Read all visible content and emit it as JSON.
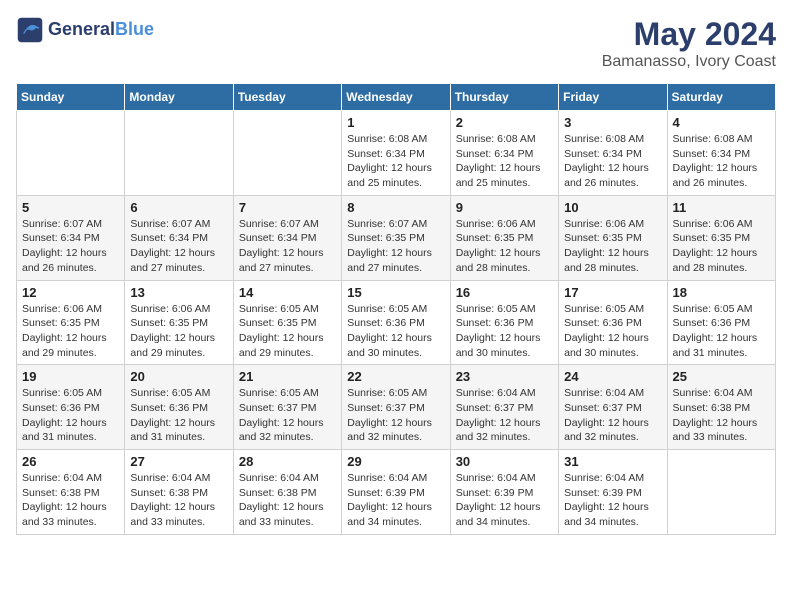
{
  "header": {
    "logo_line1": "General",
    "logo_line2": "Blue",
    "title": "May 2024",
    "subtitle": "Bamanasso, Ivory Coast"
  },
  "weekdays": [
    "Sunday",
    "Monday",
    "Tuesday",
    "Wednesday",
    "Thursday",
    "Friday",
    "Saturday"
  ],
  "weeks": [
    [
      {
        "day": "",
        "info": ""
      },
      {
        "day": "",
        "info": ""
      },
      {
        "day": "",
        "info": ""
      },
      {
        "day": "1",
        "info": "Sunrise: 6:08 AM\nSunset: 6:34 PM\nDaylight: 12 hours\nand 25 minutes."
      },
      {
        "day": "2",
        "info": "Sunrise: 6:08 AM\nSunset: 6:34 PM\nDaylight: 12 hours\nand 25 minutes."
      },
      {
        "day": "3",
        "info": "Sunrise: 6:08 AM\nSunset: 6:34 PM\nDaylight: 12 hours\nand 26 minutes."
      },
      {
        "day": "4",
        "info": "Sunrise: 6:08 AM\nSunset: 6:34 PM\nDaylight: 12 hours\nand 26 minutes."
      }
    ],
    [
      {
        "day": "5",
        "info": "Sunrise: 6:07 AM\nSunset: 6:34 PM\nDaylight: 12 hours\nand 26 minutes."
      },
      {
        "day": "6",
        "info": "Sunrise: 6:07 AM\nSunset: 6:34 PM\nDaylight: 12 hours\nand 27 minutes."
      },
      {
        "day": "7",
        "info": "Sunrise: 6:07 AM\nSunset: 6:34 PM\nDaylight: 12 hours\nand 27 minutes."
      },
      {
        "day": "8",
        "info": "Sunrise: 6:07 AM\nSunset: 6:35 PM\nDaylight: 12 hours\nand 27 minutes."
      },
      {
        "day": "9",
        "info": "Sunrise: 6:06 AM\nSunset: 6:35 PM\nDaylight: 12 hours\nand 28 minutes."
      },
      {
        "day": "10",
        "info": "Sunrise: 6:06 AM\nSunset: 6:35 PM\nDaylight: 12 hours\nand 28 minutes."
      },
      {
        "day": "11",
        "info": "Sunrise: 6:06 AM\nSunset: 6:35 PM\nDaylight: 12 hours\nand 28 minutes."
      }
    ],
    [
      {
        "day": "12",
        "info": "Sunrise: 6:06 AM\nSunset: 6:35 PM\nDaylight: 12 hours\nand 29 minutes."
      },
      {
        "day": "13",
        "info": "Sunrise: 6:06 AM\nSunset: 6:35 PM\nDaylight: 12 hours\nand 29 minutes."
      },
      {
        "day": "14",
        "info": "Sunrise: 6:05 AM\nSunset: 6:35 PM\nDaylight: 12 hours\nand 29 minutes."
      },
      {
        "day": "15",
        "info": "Sunrise: 6:05 AM\nSunset: 6:36 PM\nDaylight: 12 hours\nand 30 minutes."
      },
      {
        "day": "16",
        "info": "Sunrise: 6:05 AM\nSunset: 6:36 PM\nDaylight: 12 hours\nand 30 minutes."
      },
      {
        "day": "17",
        "info": "Sunrise: 6:05 AM\nSunset: 6:36 PM\nDaylight: 12 hours\nand 30 minutes."
      },
      {
        "day": "18",
        "info": "Sunrise: 6:05 AM\nSunset: 6:36 PM\nDaylight: 12 hours\nand 31 minutes."
      }
    ],
    [
      {
        "day": "19",
        "info": "Sunrise: 6:05 AM\nSunset: 6:36 PM\nDaylight: 12 hours\nand 31 minutes."
      },
      {
        "day": "20",
        "info": "Sunrise: 6:05 AM\nSunset: 6:36 PM\nDaylight: 12 hours\nand 31 minutes."
      },
      {
        "day": "21",
        "info": "Sunrise: 6:05 AM\nSunset: 6:37 PM\nDaylight: 12 hours\nand 32 minutes."
      },
      {
        "day": "22",
        "info": "Sunrise: 6:05 AM\nSunset: 6:37 PM\nDaylight: 12 hours\nand 32 minutes."
      },
      {
        "day": "23",
        "info": "Sunrise: 6:04 AM\nSunset: 6:37 PM\nDaylight: 12 hours\nand 32 minutes."
      },
      {
        "day": "24",
        "info": "Sunrise: 6:04 AM\nSunset: 6:37 PM\nDaylight: 12 hours\nand 32 minutes."
      },
      {
        "day": "25",
        "info": "Sunrise: 6:04 AM\nSunset: 6:38 PM\nDaylight: 12 hours\nand 33 minutes."
      }
    ],
    [
      {
        "day": "26",
        "info": "Sunrise: 6:04 AM\nSunset: 6:38 PM\nDaylight: 12 hours\nand 33 minutes."
      },
      {
        "day": "27",
        "info": "Sunrise: 6:04 AM\nSunset: 6:38 PM\nDaylight: 12 hours\nand 33 minutes."
      },
      {
        "day": "28",
        "info": "Sunrise: 6:04 AM\nSunset: 6:38 PM\nDaylight: 12 hours\nand 33 minutes."
      },
      {
        "day": "29",
        "info": "Sunrise: 6:04 AM\nSunset: 6:39 PM\nDaylight: 12 hours\nand 34 minutes."
      },
      {
        "day": "30",
        "info": "Sunrise: 6:04 AM\nSunset: 6:39 PM\nDaylight: 12 hours\nand 34 minutes."
      },
      {
        "day": "31",
        "info": "Sunrise: 6:04 AM\nSunset: 6:39 PM\nDaylight: 12 hours\nand 34 minutes."
      },
      {
        "day": "",
        "info": ""
      }
    ]
  ]
}
